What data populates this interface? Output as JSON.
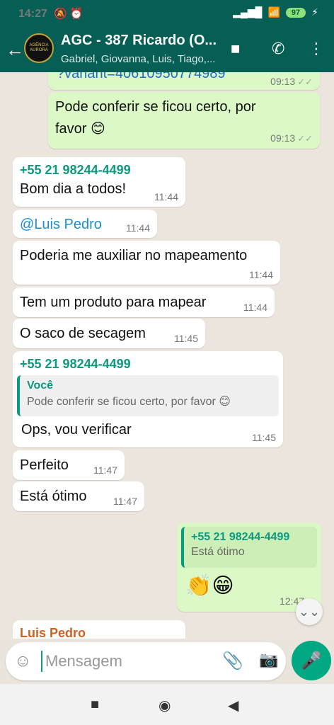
{
  "status_bar": {
    "time": "14:27",
    "left_icons": "🔕 ⏰",
    "battery": "97",
    "signal": "▂▄▆█",
    "wifi": "📶",
    "charge": "⚡"
  },
  "header": {
    "back": "←",
    "avatar_text": "AGÊNCIA AURORA",
    "title": "AGC - 387 Ricardo (O...",
    "subtitle": "Gabriel, Giovanna, Luis, Tiago,...",
    "video_icon": "■",
    "call_icon": "✆",
    "menu_icon": "⋮"
  },
  "messages": {
    "m0": {
      "text": "?variant=40610950774989",
      "time": "09:13",
      "ticks": "✓✓"
    },
    "m1": {
      "text": "Pode conferir se ficou certo, por favor 😊",
      "time": "09:13",
      "ticks": "✓✓"
    },
    "m2": {
      "sender": "+55 21 98244-4499",
      "text": "Bom dia a todos!",
      "time": "11:44"
    },
    "m3": {
      "text": "@Luis Pedro",
      "time": "11:44"
    },
    "m4": {
      "text": "Poderia me auxiliar no mapeamento",
      "time": "11:44"
    },
    "m5": {
      "text": "Tem um produto para mapear",
      "time": "11:44"
    },
    "m6": {
      "text": "O saco de secagem",
      "time": "11:45"
    },
    "m7": {
      "sender": "+55 21 98244-4499",
      "quote_name": "Você",
      "quote_text": "Pode conferir se ficou certo, por favor 😊",
      "text": "Ops, vou verificar",
      "time": "11:45"
    },
    "m8": {
      "text": "Perfeito",
      "time": "11:47"
    },
    "m9": {
      "text": "Está ótimo",
      "time": "11:47"
    },
    "m10": {
      "quote_name": "+55 21 98244-4499",
      "quote_text": "Está ótimo",
      "text": "👏😁",
      "time": "12:47",
      "ticks": "✓"
    },
    "m11": {
      "sender": "Luis Pedro"
    }
  },
  "scroll_down_icon": "⌄⌄",
  "composer": {
    "placeholder": "Mensagem",
    "emoji_icon": "☺",
    "attach_icon": "📎",
    "camera_icon": "📷",
    "mic_icon": "🎤"
  },
  "nav": {
    "recents": "■",
    "home": "◉",
    "back": "◀"
  }
}
